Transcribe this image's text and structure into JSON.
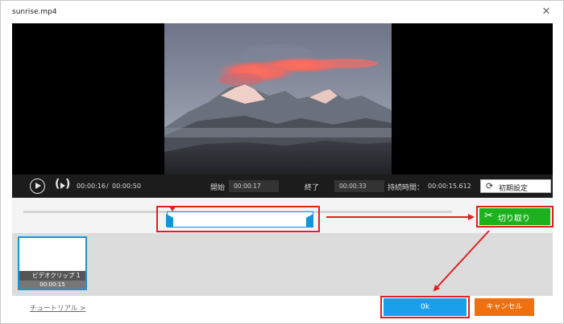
{
  "window": {
    "title": "sunrise.mp4"
  },
  "controls": {
    "current_time": "00:00:16",
    "separator": "/",
    "total_time": "00:00:50",
    "start_label": "開始",
    "start_value": "00:00:17",
    "end_label": "終了",
    "end_value": "00:00:33",
    "duration_label": "持続時間：",
    "duration_value": "00:00:15.612",
    "reset_label": "初期設定"
  },
  "cut": {
    "label": "切り取り"
  },
  "clips": [
    {
      "name": "ビデオクリップ 1",
      "time": "00:00:15"
    }
  ],
  "footer": {
    "tutorial_label": "チュートリアル >",
    "ok_label": "0k",
    "cancel_label": "キャンセル"
  },
  "colors": {
    "accent": "#1296db",
    "cut_green": "#1db21d",
    "ok_blue": "#1aa0ea",
    "cancel_orange": "#f07010",
    "highlight_red": "#e02020"
  }
}
